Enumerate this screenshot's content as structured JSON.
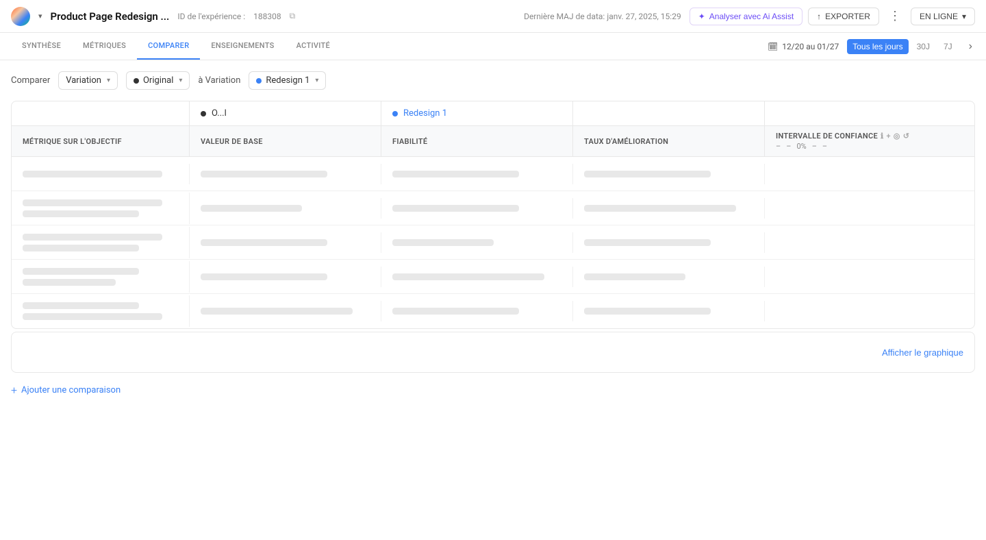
{
  "header": {
    "title": "Product Page Redesign ...",
    "id_label": "ID de l'expérience :",
    "id_value": "188308",
    "date_label": "Dernière MAJ de data: janv. 27, 2025, 15:29",
    "btn_ai": "Analyser avec Ai Assist",
    "btn_export": "EXPORTER",
    "btn_online": "EN LIGNE"
  },
  "nav": {
    "tabs": [
      {
        "id": "synthese",
        "label": "SYNTHÈSE"
      },
      {
        "id": "metriques",
        "label": "MÉTRIQUES"
      },
      {
        "id": "comparer",
        "label": "COMPARER"
      },
      {
        "id": "enseignements",
        "label": "ENSEIGNEMENTS"
      },
      {
        "id": "activite",
        "label": "ACTIVITÉ"
      }
    ],
    "active_tab": "comparer",
    "date_range": "12/20 au 01/27",
    "period_options": [
      {
        "label": "Tous les jours",
        "active": true
      },
      {
        "label": "30J",
        "active": false
      },
      {
        "label": "7J",
        "active": false
      }
    ]
  },
  "compare": {
    "label": "Comparer",
    "type_label": "Variation",
    "from_dot": "black",
    "from_value": "Original",
    "to_label": "à Variation",
    "to_dot": "blue",
    "to_value": "Redesign 1"
  },
  "table": {
    "col0_header": "",
    "variations": [
      {
        "label": "O...l",
        "dot": "black"
      },
      {
        "label": "Redesign 1",
        "dot": "blue"
      }
    ],
    "columns": [
      {
        "id": "metric",
        "label": "Métrique sur l'objectif"
      },
      {
        "id": "baseline",
        "label": "Valeur de base"
      },
      {
        "id": "reliability",
        "label": "Fiabilité"
      },
      {
        "id": "improvement",
        "label": "Taux d'amélioration"
      },
      {
        "id": "confidence",
        "label": "Intervalle de confiance",
        "has_info": true,
        "sub": [
          "–",
          "–",
          "0%",
          "–",
          "–"
        ]
      }
    ],
    "rows": [
      {
        "type": "skeleton",
        "sizes": [
          "lg",
          "md",
          "md",
          "md",
          ""
        ]
      },
      {
        "type": "skeleton",
        "sizes": [
          "md",
          "sm",
          "md",
          "lg",
          ""
        ]
      },
      {
        "type": "skeleton",
        "sizes": [
          "lg",
          "md",
          "sm",
          "md",
          ""
        ]
      },
      {
        "type": "skeleton",
        "sizes": [
          "sm",
          "md",
          "lg",
          "sm",
          ""
        ]
      },
      {
        "type": "skeleton",
        "sizes": [
          "md",
          "lg",
          "md",
          "md",
          ""
        ]
      }
    ]
  },
  "chart_area": {
    "show_chart_btn": "Afficher le graphique"
  },
  "add_comparison": {
    "label": "Ajouter une comparaison",
    "icon": "+"
  }
}
